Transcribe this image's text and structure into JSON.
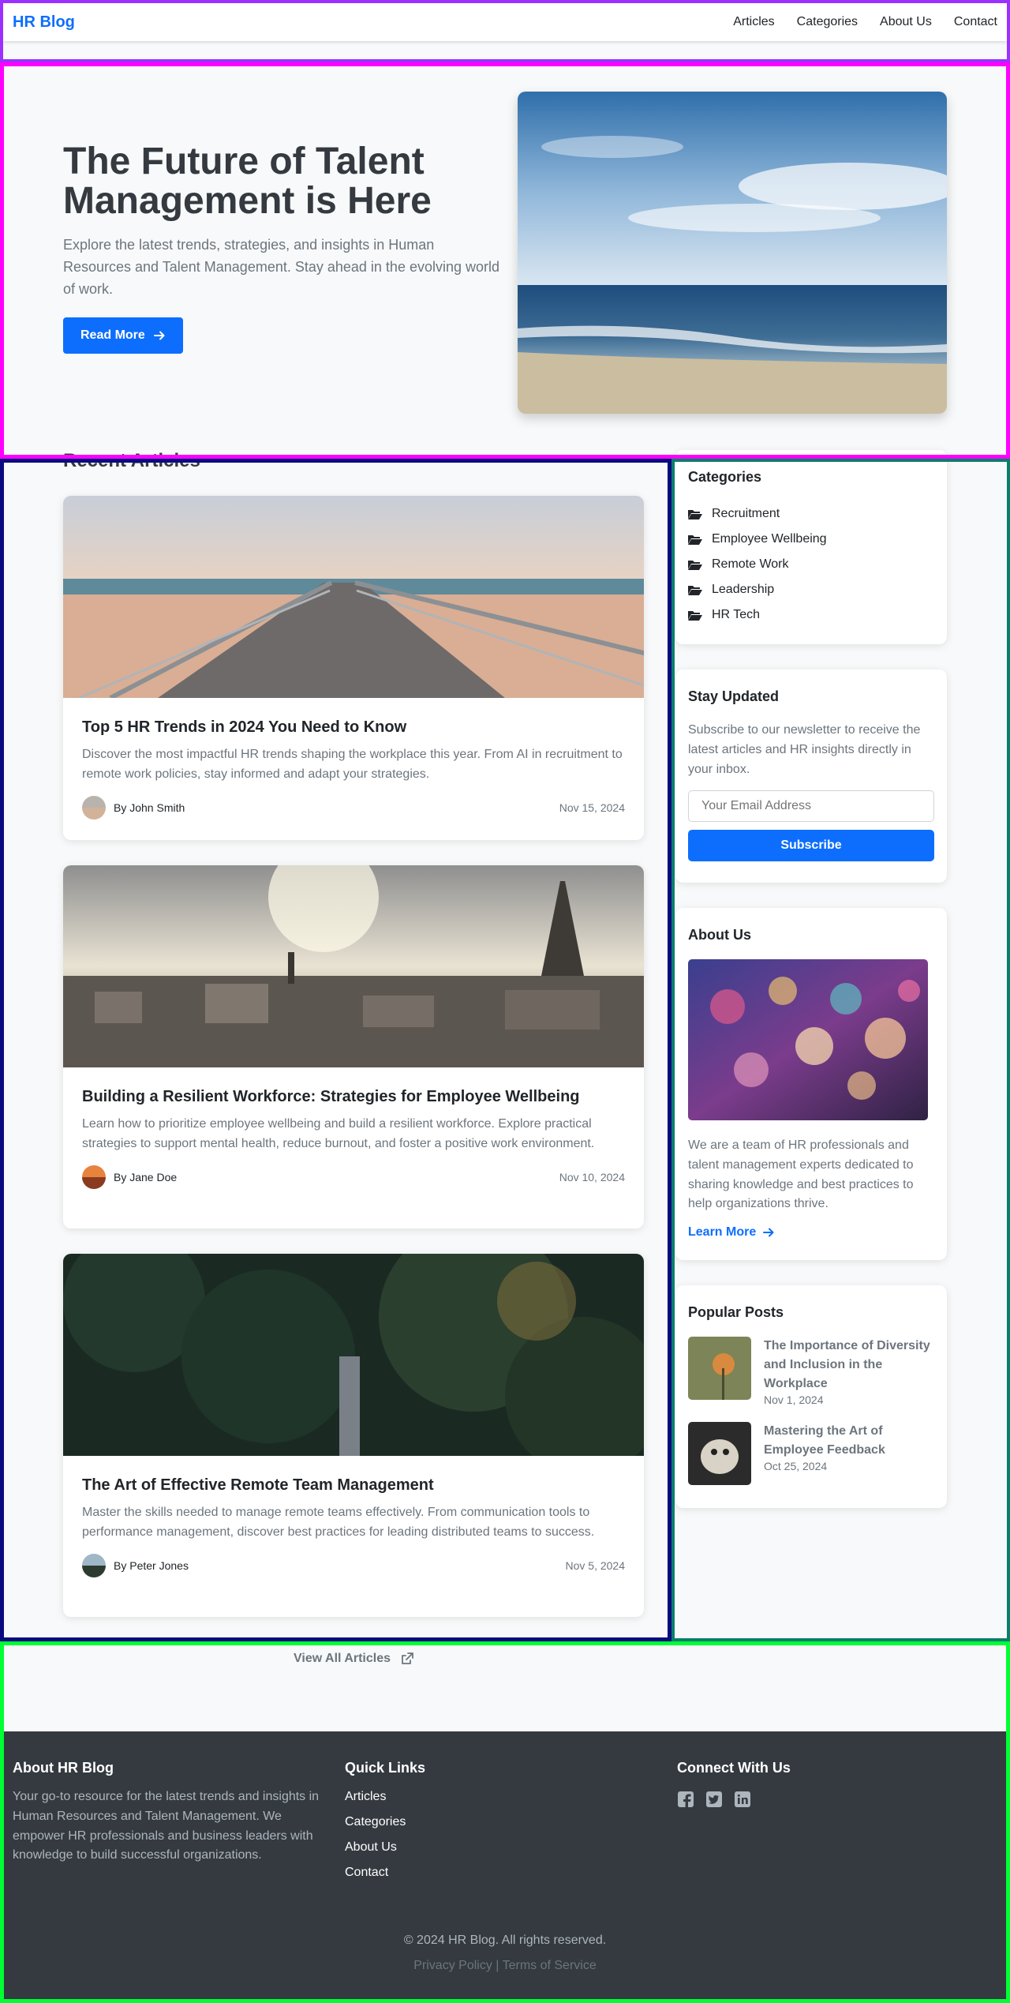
{
  "nav": {
    "brand": "HR Blog",
    "links": [
      "Articles",
      "Categories",
      "About Us",
      "Contact"
    ]
  },
  "hero": {
    "title": "The Future of Talent Management is Here",
    "description": "Explore the latest trends, strategies, and insights in Human Resources and Talent Management. Stay ahead in the evolving world of work.",
    "button": "Read More"
  },
  "articles": {
    "section_title": "Recent Articles",
    "items": [
      {
        "title": "Top 5 HR Trends in 2024 You Need to Know",
        "excerpt": "Discover the most impactful HR trends shaping the workplace this year. From AI in recruitment to remote work policies, stay informed and adapt your strategies.",
        "author": "By John Smith",
        "date": "Nov 15, 2024"
      },
      {
        "title": "Building a Resilient Workforce: Strategies for Employee Wellbeing",
        "excerpt": "Learn how to prioritize employee wellbeing and build a resilient workforce. Explore practical strategies to support mental health, reduce burnout, and foster a positive work environment.",
        "author": "By Jane Doe",
        "date": "Nov 10, 2024"
      },
      {
        "title": "The Art of Effective Remote Team Management",
        "excerpt": "Master the skills needed to manage remote teams effectively. From communication tools to performance management, discover best practices for leading distributed teams to success.",
        "author": "By Peter Jones",
        "date": "Nov 5, 2024"
      }
    ],
    "view_all": "View All Articles"
  },
  "sidebar": {
    "categories": {
      "title": "Categories",
      "items": [
        "Recruitment",
        "Employee Wellbeing",
        "Remote Work",
        "Leadership",
        "HR Tech"
      ]
    },
    "newsletter": {
      "title": "Stay Updated",
      "text": "Subscribe to our newsletter to receive the latest articles and HR insights directly in your inbox.",
      "placeholder": "Your Email Address",
      "button": "Subscribe"
    },
    "about": {
      "title": "About Us",
      "text": "We are a team of HR professionals and talent management experts dedicated to sharing knowledge and best practices to help organizations thrive.",
      "link": "Learn More"
    },
    "popular": {
      "title": "Popular Posts",
      "items": [
        {
          "title": "The Importance of Diversity and Inclusion in the Workplace",
          "date": "Nov 1, 2024"
        },
        {
          "title": "Mastering the Art of Employee Feedback",
          "date": "Oct 25, 2024"
        }
      ]
    }
  },
  "footer": {
    "about": {
      "title": "About HR Blog",
      "text": "Your go-to resource for the latest trends and insights in Human Resources and Talent Management. We empower HR professionals and business leaders with knowledge to build successful organizations."
    },
    "quick_links": {
      "title": "Quick Links",
      "items": [
        "Articles",
        "Categories",
        "About Us",
        "Contact"
      ]
    },
    "connect": {
      "title": "Connect With Us",
      "icons": [
        "facebook-icon",
        "twitter-icon",
        "linkedin-icon"
      ]
    },
    "copyright": "© 2024 HR Blog. All rights reserved.",
    "privacy": "Privacy Policy",
    "separator": "|",
    "terms": "Terms of Service"
  },
  "colors": {
    "primary": "#0d6efd",
    "dark": "#343a40",
    "muted": "#6c757d",
    "background": "#f8f9fa"
  }
}
